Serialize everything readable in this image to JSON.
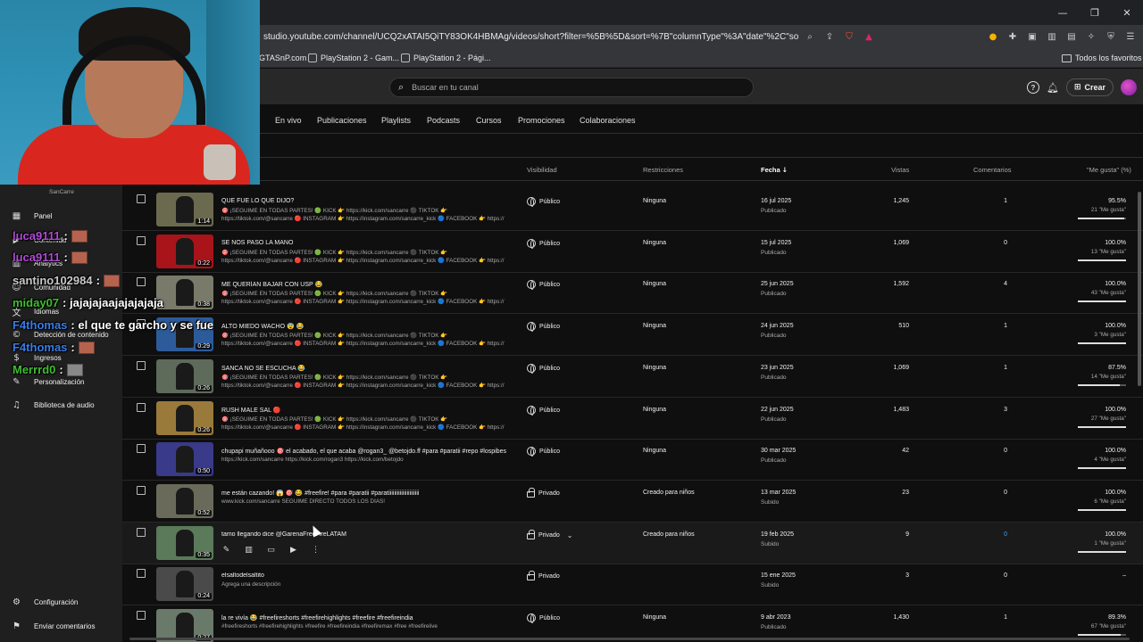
{
  "browser": {
    "url": "studio.youtube.com/channel/UCQ2xATAI5QiTY83OK4HBMAg/videos/short?filter=%5B%5D&sort=%7B\"columnType\"%3A\"date\"%2C\"sortOrder\"...",
    "bookmarks": [
      "GTASnP.com",
      "PlayStation 2 - Gam...",
      "PlayStation 2 - Pági..."
    ],
    "all_bookmarks_label": "Todos los favoritos"
  },
  "header": {
    "search_placeholder": "Buscar en tu canal",
    "create_label": "Crear"
  },
  "tabs": [
    "En vivo",
    "Publicaciones",
    "Playlists",
    "Podcasts",
    "Cursos",
    "Promociones",
    "Colaboraciones"
  ],
  "columns": {
    "visibility": "Visibilidad",
    "restrictions": "Restricciones",
    "date": "Fecha",
    "views": "Vistas",
    "comments": "Comentarios",
    "likes": "\"Me gusta\" (%)"
  },
  "sidebar": {
    "channel_name": "SanCarre",
    "items": [
      {
        "label": "Panel",
        "icon": "dashboard-icon"
      },
      {
        "label": "Contenido",
        "icon": "content-icon"
      },
      {
        "label": "Analytics",
        "icon": "analytics-icon"
      },
      {
        "label": "Comunidad",
        "icon": "community-icon"
      },
      {
        "label": "Idiomas",
        "icon": "languages-icon"
      },
      {
        "label": "Detección de contenido",
        "icon": "content-detection-icon"
      },
      {
        "label": "Ingresos",
        "icon": "earn-icon"
      },
      {
        "label": "Personalización",
        "icon": "customization-icon"
      },
      {
        "label": "Biblioteca de audio",
        "icon": "audio-library-icon"
      }
    ],
    "settings_label": "Configuración",
    "feedback_label": "Enviar comentarios"
  },
  "chat": [
    {
      "user": "luca9111",
      "color": "#b04ad6",
      "message": ":"
    },
    {
      "user": "luca9111",
      "color": "#b04ad6",
      "message": ":"
    },
    {
      "user": "santino102984",
      "color": "#c9c9c9",
      "message": ":"
    },
    {
      "user": "miday07",
      "color": "#3fbf2f",
      "message": ": jajajajaajajajajaja"
    },
    {
      "user": "F4thomas",
      "color": "#3a7ce6",
      "message": ": el que te garcho y se fue"
    },
    {
      "user": "F4thomas",
      "color": "#3a7ce6",
      "message": ":"
    },
    {
      "user": "Merrrd0",
      "color": "#3fbf2f",
      "message": ":"
    }
  ],
  "videos": [
    {
      "title": "QUE FUE LO QUE DIJO?",
      "desc1": "🎯 ¡SEGUIME EN TODAS PARTES! 🟢 KICK 👉 https://kick.com/sancarre ⚫ TIKTOK 👉",
      "desc2": "https://tiktok.com/@sancarre 🔴 INSTAGRAM 👉 https://instagram.com/sancarre_kick 🔵 FACEBOOK 👉 https://",
      "duration": "1:14",
      "visibility": "Público",
      "restrictions": "Ninguna",
      "date": "16 jul 2025",
      "date_status": "Publicado",
      "views": "1,245",
      "comments": "1",
      "likes_pct": "95.5%",
      "likes_count": "21 \"Me gusta\"",
      "like_ratio": 0.955,
      "thumb": "#6b6a4e"
    },
    {
      "title": "SE NOS PASÓ LA MANO",
      "desc1": "🎯 ¡SEGUIME EN TODAS PARTES! 🟢 KICK 👉 https://kick.com/sancarre ⚫ TIKTOK 👉",
      "desc2": "https://tiktok.com/@sancarre 🔴 INSTAGRAM 👉 https://instagram.com/sancarre_kick 🔵 FACEBOOK 👉 https://",
      "duration": "0:22",
      "visibility": "Público",
      "restrictions": "Ninguna",
      "date": "15 jul 2025",
      "date_status": "Publicado",
      "views": "1,069",
      "comments": "0",
      "likes_pct": "100.0%",
      "likes_count": "13 \"Me gusta\"",
      "like_ratio": 1.0,
      "thumb": "#a8141a"
    },
    {
      "title": "ME QUERÍAN BAJAR CON USP 😂",
      "desc1": "🎯 ¡SEGUIME EN TODAS PARTES! 🟢 KICK 👉 https://kick.com/sancarre ⚫ TIKTOK 👉",
      "desc2": "https://tiktok.com/@sancarre 🔴 INSTAGRAM 👉 https://instagram.com/sancarre_kick 🔵 FACEBOOK 👉 https://",
      "duration": "0:38",
      "visibility": "Público",
      "restrictions": "Ninguna",
      "date": "25 jun 2025",
      "date_status": "Publicado",
      "views": "1,592",
      "comments": "4",
      "likes_pct": "100.0%",
      "likes_count": "43 \"Me gusta\"",
      "like_ratio": 1.0,
      "thumb": "#7a7a6a"
    },
    {
      "title": "ALTO MIEDO WACHO 😨 😂",
      "desc1": "🎯 ¡SEGUIME EN TODAS PARTES! 🟢 KICK 👉 https://kick.com/sancarre ⚫ TIKTOK 👉",
      "desc2": "https://tiktok.com/@sancarre 🔴 INSTAGRAM 👉 https://instagram.com/sancarre_kick 🔵 FACEBOOK 👉 https://",
      "duration": "0:29",
      "visibility": "Público",
      "restrictions": "Ninguna",
      "date": "24 jun 2025",
      "date_status": "Publicado",
      "views": "510",
      "comments": "1",
      "likes_pct": "100.0%",
      "likes_count": "3 \"Me gusta\"",
      "like_ratio": 1.0,
      "thumb": "#2d5b9a"
    },
    {
      "title": "SANCA NO SE ESCUCHA 😂",
      "desc1": "🎯 ¡SEGUIME EN TODAS PARTES! 🟢 KICK 👉 https://kick.com/sancarre ⚫ TIKTOK 👉",
      "desc2": "https://tiktok.com/@sancarre 🔴 INSTAGRAM 👉 https://instagram.com/sancarre_kick 🔵 FACEBOOK 👉 https://",
      "duration": "0:26",
      "visibility": "Público",
      "restrictions": "Ninguna",
      "date": "23 jun 2025",
      "date_status": "Publicado",
      "views": "1,069",
      "comments": "1",
      "likes_pct": "87.5%",
      "likes_count": "14 \"Me gusta\"",
      "like_ratio": 0.875,
      "thumb": "#5e6a5a"
    },
    {
      "title": "RUSH MALE SAL 🔴",
      "desc1": "🎯 ¡SEGUIME EN TODAS PARTES! 🟢 KICK 👉 https://kick.com/sancarre ⚫ TIKTOK 👉",
      "desc2": "https://tiktok.com/@sancarre 🔴 INSTAGRAM 👉 https://instagram.com/sancarre_kick 🔵 FACEBOOK 👉 https://",
      "duration": "0:26",
      "visibility": "Público",
      "restrictions": "Ninguna",
      "date": "22 jun 2025",
      "date_status": "Publicado",
      "views": "1,483",
      "comments": "3",
      "likes_pct": "100.0%",
      "likes_count": "27 \"Me gusta\"",
      "like_ratio": 1.0,
      "thumb": "#9a7a3a"
    },
    {
      "title": "chupapi muñañooo 🎯 el acabado, el que acaba @rogan3_ @betojdo.ff #para #paratii #repo #lospibes",
      "desc1": "https://kick.com/sancarre https://kick.com/rogan3 https://kick.com/betojdo",
      "desc2": "",
      "duration": "0:50",
      "visibility": "Público",
      "restrictions": "Ninguna",
      "date": "30 mar 2025",
      "date_status": "Publicado",
      "views": "42",
      "comments": "0",
      "likes_pct": "100.0%",
      "likes_count": "4 \"Me gusta\"",
      "like_ratio": 1.0,
      "thumb": "#3a3a8a"
    },
    {
      "title": "me están cazando! 😱 🎯 😂 #freefire! #para #paratii #paratiiiiiiiiiiiiiiiiiiiiii",
      "desc1": "www.kick.com/sancarre SEGUIME DIRECTO TODOS LOS DÍAS!",
      "desc2": "",
      "duration": "0:52",
      "visibility": "Privado",
      "restrictions": "Creado para niños",
      "date": "13 mar 2025",
      "date_status": "Subido",
      "views": "23",
      "comments": "0",
      "likes_pct": "100.0%",
      "likes_count": "6 \"Me gusta\"",
      "like_ratio": 1.0,
      "thumb": "#6a6a5a"
    },
    {
      "title": "tamo llegando dice @GarenaFreeFireLATAM",
      "desc1": "",
      "desc2": "",
      "duration": "0:35",
      "visibility": "Privado",
      "restrictions": "Creado para niños",
      "date": "19 feb 2025",
      "date_status": "Subido",
      "views": "9",
      "comments": "0",
      "likes_pct": "100.0%",
      "likes_count": "1 \"Me gusta\"",
      "like_ratio": 1.0,
      "thumb": "#5a7a5a",
      "hover": true
    },
    {
      "title": "elsaltodelsaltito",
      "desc1": "Agrega una descripción",
      "desc2": "",
      "duration": "0:24",
      "visibility": "Privado",
      "restrictions": "",
      "date": "15 ene 2025",
      "date_status": "Subido",
      "views": "3",
      "comments": "0",
      "likes_pct": "–",
      "likes_count": "",
      "like_ratio": 0,
      "thumb": "#4a4a4a"
    },
    {
      "title": "la re vivía 😂 #freefireshorts #freefirehighlights #freefire #freefireindia",
      "desc1": "#freefireshorts #freefirehighlights #freefire #freefireindia #freefiremax #free #freefirelive",
      "desc2": "",
      "duration": "0:27",
      "visibility": "Público",
      "restrictions": "Ninguna",
      "date": "9 abr 2023",
      "date_status": "Publicado",
      "views": "1,430",
      "comments": "1",
      "likes_pct": "89.3%",
      "likes_count": "67 \"Me gusta\"",
      "like_ratio": 0.893,
      "thumb": "#6a7a6a"
    }
  ],
  "colors": {
    "accent_blue": "#3ea6ff",
    "background": "#0f0f0f",
    "sidebar": "#1f1f1f"
  }
}
